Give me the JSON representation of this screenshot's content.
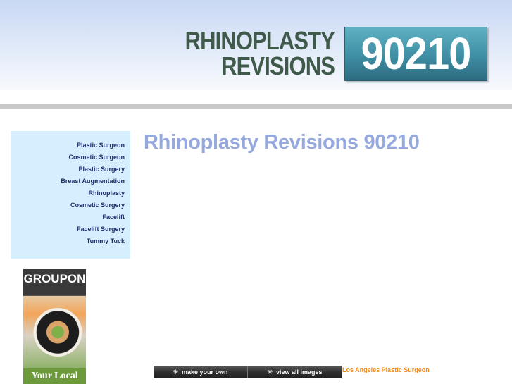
{
  "header": {
    "logo_line1": "RHINOPLASTY",
    "logo_line2": "REVISIONS",
    "logo_number": "90210",
    "colors": {
      "logo_text": "#3f5a4a",
      "logo_box": "#3f8ea3"
    }
  },
  "sidebar": {
    "items": [
      {
        "label": "Plastic Surgeon"
      },
      {
        "label": "Cosmetic Surgeon"
      },
      {
        "label": "Plastic Surgery"
      },
      {
        "label": "Breast Augmentation"
      },
      {
        "label": "Rhinoplasty"
      },
      {
        "label": "Cosmetic Surgery"
      },
      {
        "label": "Facelift"
      },
      {
        "label": "Facelift Surgery"
      },
      {
        "label": "Tummy Tuck"
      }
    ],
    "colors": {
      "background": "#d5efff",
      "link": "#1e2d6a"
    }
  },
  "main": {
    "title": "Rhinoplasty Revisions 90210",
    "title_color": "#96a9de"
  },
  "ad": {
    "brand": "GROUPON",
    "tagline": "Your Local"
  },
  "footer": {
    "buttons": [
      {
        "label": "make your own",
        "icon": "sparkle-icon"
      },
      {
        "label": "view all images",
        "icon": "sparkle-icon"
      }
    ],
    "link_label": "Los Angeles Plastic Surgeon",
    "link_color": "#f08a1e"
  }
}
